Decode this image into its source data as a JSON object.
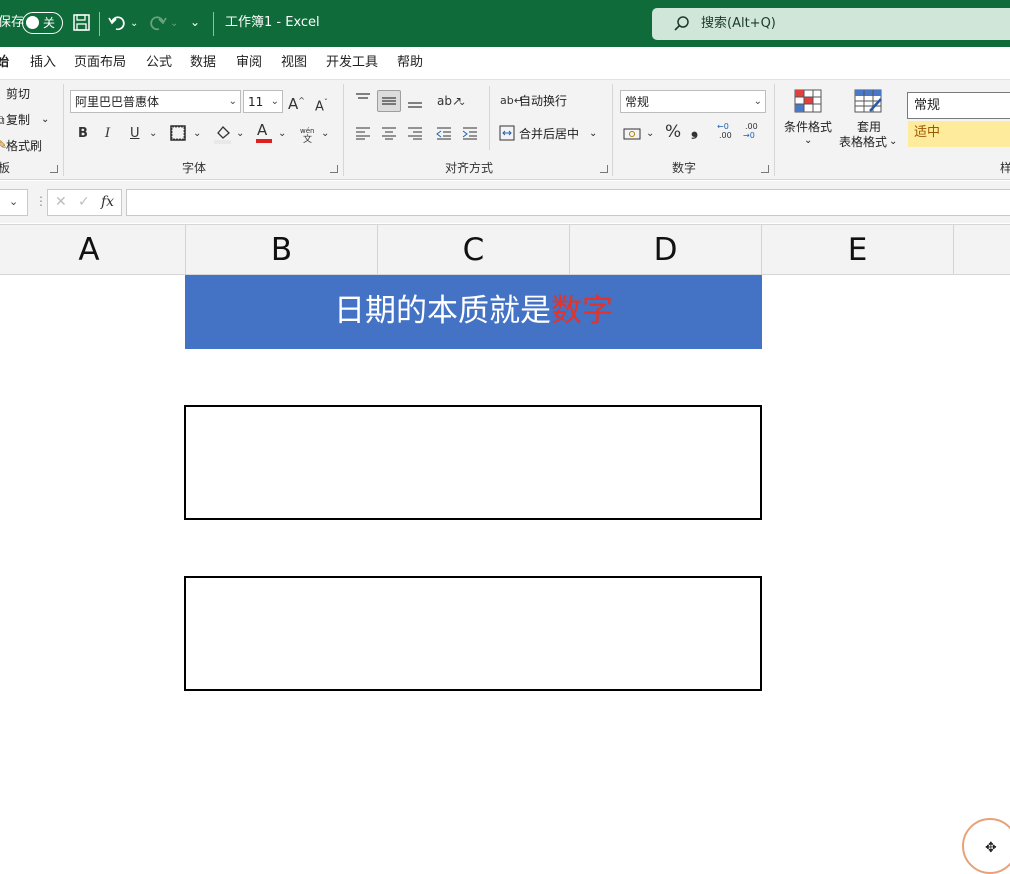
{
  "titlebar": {
    "autosave_label": "保存",
    "autosave_toggle": "关",
    "doc_title": "工作簿1  -  Excel",
    "search_placeholder": "搜索(Alt+Q)",
    "background": "#0f6b3a"
  },
  "ribbon_tabs": [
    "始",
    "插入",
    "页面布局",
    "公式",
    "数据",
    "审阅",
    "视图",
    "开发工具",
    "帮助"
  ],
  "clipboard": {
    "cut": "剪切",
    "copy": "复制",
    "format_painter": "格式刷",
    "group_label": "板"
  },
  "font": {
    "font_name": "阿里巴巴普惠体",
    "font_size": "11",
    "bold": "B",
    "italic": "I",
    "underline": "U",
    "font_color_glyph": "A",
    "phonetic_top": "wén",
    "phonetic_bottom": "文",
    "group_label": "字体"
  },
  "alignment": {
    "wrap_text": "自动换行",
    "merge_center": "合并后居中",
    "group_label": "对齐方式"
  },
  "number": {
    "format": "常规",
    "percent": "%",
    "comma": "❟",
    "increase_decimal_top": "←0",
    "increase_decimal_bottom": ".00",
    "decrease_decimal_top": ".00",
    "decrease_decimal_bottom": "→0",
    "group_label": "数字"
  },
  "styles": {
    "conditional_formatting": "条件格式",
    "format_as_table_line1": "套用",
    "format_as_table_line2": "表格格式",
    "style_normal": "常规",
    "style_neutral": "适中",
    "group_label_partial": "样"
  },
  "formula_bar": {
    "fx": "fx",
    "cancel": "✕",
    "enter": "✓",
    "content": ""
  },
  "columns": [
    "A",
    "B",
    "C",
    "D",
    "E"
  ],
  "sheet": {
    "banner_text": "日期的本质就是",
    "banner_highlight": "数字",
    "banner_color": "#4472c4",
    "highlight_color": "#e63228"
  }
}
